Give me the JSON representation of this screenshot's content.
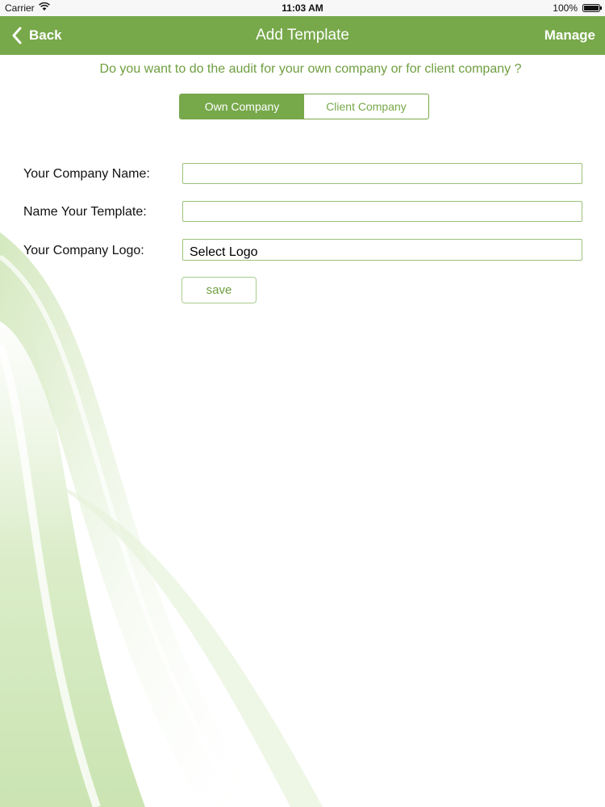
{
  "status_bar": {
    "carrier": "Carrier",
    "time": "11:03 AM",
    "battery": "100%"
  },
  "nav": {
    "back_label": "Back",
    "title": "Add Template",
    "manage_label": "Manage"
  },
  "question": "Do you want to do the audit for your own company or for client company ?",
  "segments": [
    {
      "label": "Own Company",
      "selected": true
    },
    {
      "label": "Client Company",
      "selected": false
    }
  ],
  "form": {
    "company_name_label": "Your Company Name:",
    "company_name_value": "",
    "template_name_label": "Name Your Template:",
    "template_name_value": "",
    "logo_label": "Your Company Logo:",
    "logo_button": "Select Logo",
    "save_label": "save"
  },
  "colors": {
    "accent": "#77a84a",
    "accent_text": "#6f9e40"
  }
}
